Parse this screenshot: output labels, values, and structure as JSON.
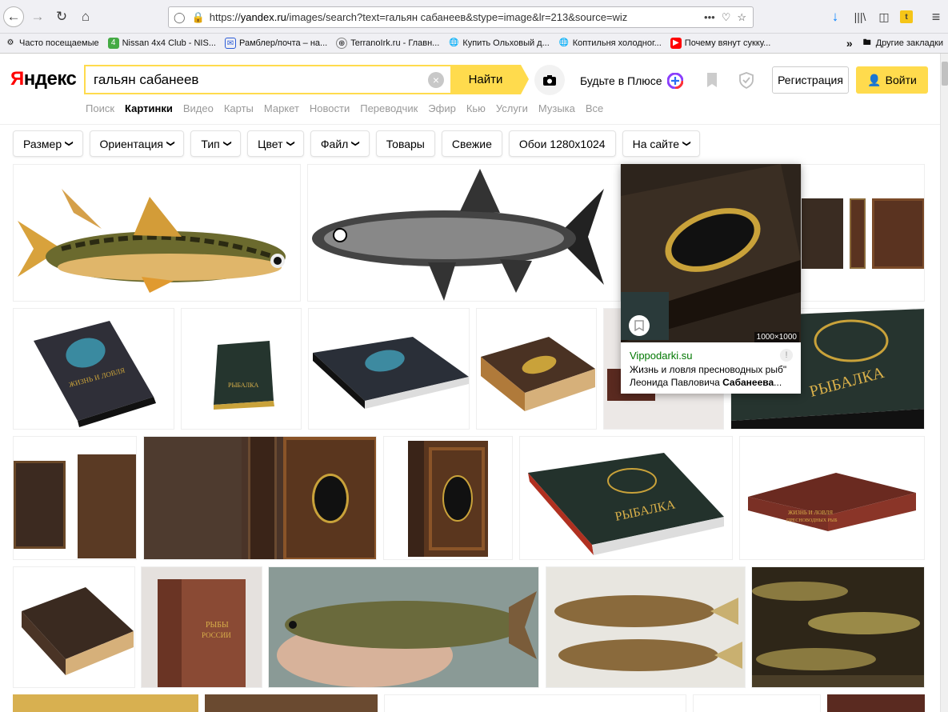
{
  "browser": {
    "url_prefix": "https://",
    "url_domain": "yandex.ru",
    "url_rest": "/images/search?text=гальян сабанеев&stype=image&lr=213&source=wiz",
    "more": "•••"
  },
  "bookmarks": [
    {
      "label": "Часто посещаемые"
    },
    {
      "label": "Nissan 4x4 Club - NIS..."
    },
    {
      "label": "Рамблер/почта – на..."
    },
    {
      "label": "TerranoIrk.ru - Главн..."
    },
    {
      "label": "Купить Ольховый д..."
    },
    {
      "label": "Коптильня холодног..."
    },
    {
      "label": "Почему вянут сукку..."
    }
  ],
  "bookmarks_more": "»",
  "bookmarks_other": "Другие закладки",
  "header": {
    "logo_first": "Я",
    "logo_rest": "ндекс",
    "search_value": "гальян сабанеев",
    "search_button": "Найти",
    "plus_label": "Будьте в Плюсе",
    "register": "Регистрация",
    "login": "Войти"
  },
  "services": [
    "Поиск",
    "Картинки",
    "Видео",
    "Карты",
    "Маркет",
    "Новости",
    "Переводчик",
    "Эфир",
    "Кью",
    "Услуги",
    "Музыка",
    "Все"
  ],
  "filters": [
    {
      "label": "Размер",
      "dropdown": true
    },
    {
      "label": "Ориентация",
      "dropdown": true
    },
    {
      "label": "Тип",
      "dropdown": true
    },
    {
      "label": "Цвет",
      "dropdown": true
    },
    {
      "label": "Файл",
      "dropdown": true
    },
    {
      "label": "Товары",
      "dropdown": false
    },
    {
      "label": "Свежие",
      "dropdown": false
    },
    {
      "label": "Обои 1280x1024",
      "dropdown": false
    },
    {
      "label": "На сайте",
      "dropdown": true
    }
  ],
  "popup": {
    "size": "1000×1000",
    "domain": "Vippodarki.su",
    "desc_line1": "Жизнь и ловля пресноводных рыб\"",
    "desc_line2_plain": "Леонида Павловича ",
    "desc_line2_bold": "Сабанеева",
    "desc_line2_end": "..."
  },
  "book_labels": {
    "rybalka": "РЫБАЛКА",
    "rybalka_cyr": "РЫБАЛКА",
    "zhizn": "ЖИЗНЬ И ЛОВЛЯ",
    "presnovodnyh": "ПРЕСНОВОДНЫХ РЫБ",
    "ryby": "РЫБЫ",
    "rossii": "РОССИИ"
  },
  "colors": {
    "accent": "#ffdb4d",
    "logo_red": "#ff0000",
    "domain_green": "#007700"
  }
}
